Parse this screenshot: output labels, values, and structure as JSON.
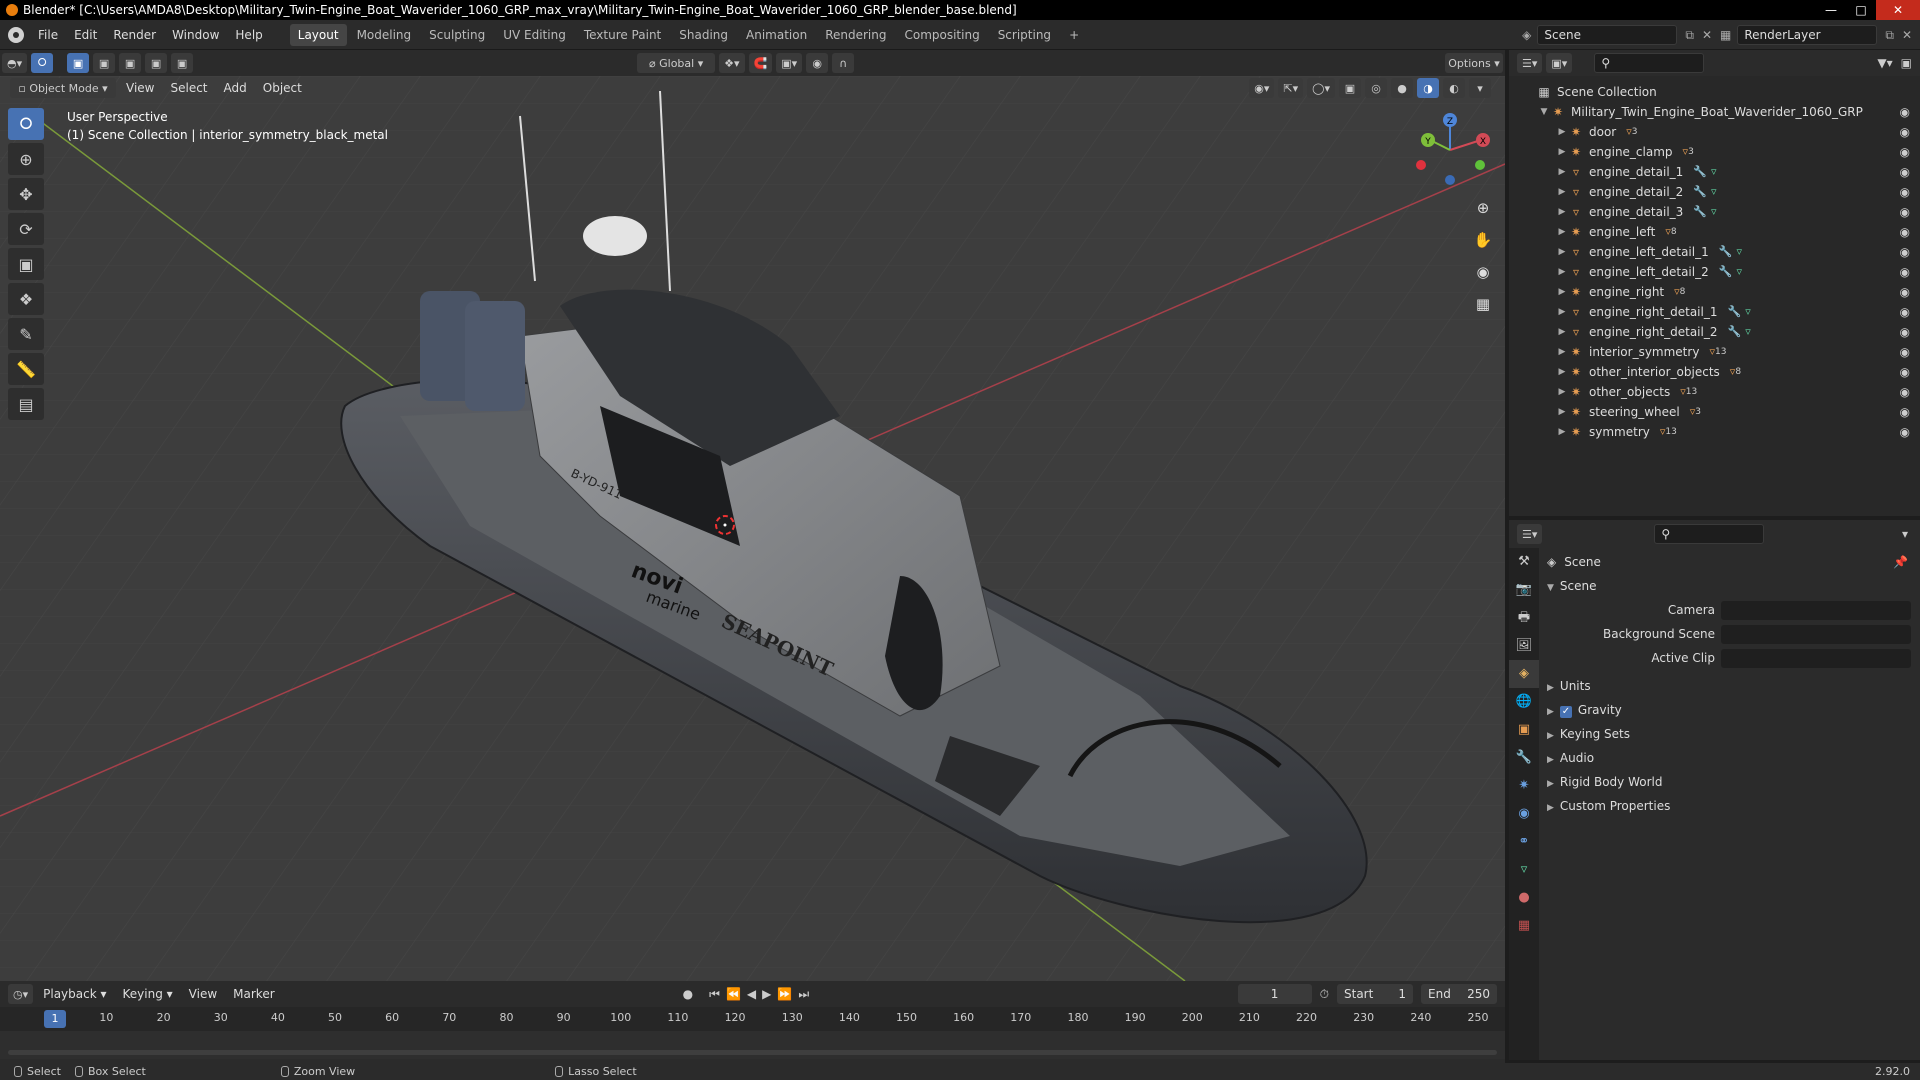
{
  "title": "Blender* [C:\\Users\\AMDA8\\Desktop\\Military_Twin-Engine_Boat_Waverider_1060_GRP_max_vray\\Military_Twin-Engine_Boat_Waverider_1060_GRP_blender_base.blend]",
  "menu": [
    "File",
    "Edit",
    "Render",
    "Window",
    "Help"
  ],
  "workspaces": [
    "Layout",
    "Modeling",
    "Sculpting",
    "UV Editing",
    "Texture Paint",
    "Shading",
    "Animation",
    "Rendering",
    "Compositing",
    "Scripting"
  ],
  "active_workspace": "Layout",
  "scene_name": "Scene",
  "render_layer": "RenderLayer",
  "tool_header": {
    "orientation": "Global",
    "options": "Options"
  },
  "viewport": {
    "mode": "Object Mode",
    "menus": [
      "View",
      "Select",
      "Add",
      "Object"
    ],
    "info_line1": "User Perspective",
    "info_line2": "(1) Scene Collection | interior_symmetry_black_metal"
  },
  "gizmo": {
    "x": "X",
    "y": "Y",
    "z": "Z"
  },
  "boat_text": {
    "brand1": "novi",
    "brand2": "marine",
    "name": "SEAPOINT",
    "reg": "B-YD-911"
  },
  "outliner": {
    "root": "Scene Collection",
    "group": "Military_Twin_Engine_Boat_Waverider_1060_GRP",
    "items": [
      {
        "name": "door",
        "sub": "3"
      },
      {
        "name": "engine_clamp",
        "sub": "3"
      },
      {
        "name": "engine_detail_1",
        "sub": ""
      },
      {
        "name": "engine_detail_2",
        "sub": ""
      },
      {
        "name": "engine_detail_3",
        "sub": ""
      },
      {
        "name": "engine_left",
        "sub": "8"
      },
      {
        "name": "engine_left_detail_1",
        "sub": ""
      },
      {
        "name": "engine_left_detail_2",
        "sub": ""
      },
      {
        "name": "engine_right",
        "sub": "8"
      },
      {
        "name": "engine_right_detail_1",
        "sub": ""
      },
      {
        "name": "engine_right_detail_2",
        "sub": ""
      },
      {
        "name": "interior_symmetry",
        "sub": "13"
      },
      {
        "name": "other_interior_objects",
        "sub": "8"
      },
      {
        "name": "other_objects",
        "sub": "13"
      },
      {
        "name": "steering_wheel",
        "sub": "3"
      },
      {
        "name": "symmetry",
        "sub": "13"
      }
    ]
  },
  "properties": {
    "context": "Scene",
    "panel": "Scene",
    "camera_label": "Camera",
    "bg_label": "Background Scene",
    "clip_label": "Active Clip",
    "sections": [
      "Units",
      "Gravity",
      "Keying Sets",
      "Audio",
      "Rigid Body World",
      "Custom Properties"
    ]
  },
  "timeline": {
    "menus": [
      "Playback",
      "Keying",
      "View",
      "Marker"
    ],
    "current": "1",
    "start_label": "Start",
    "start": "1",
    "end_label": "End",
    "end": "250",
    "ticks": [
      "1",
      "10",
      "20",
      "30",
      "40",
      "50",
      "60",
      "70",
      "80",
      "90",
      "100",
      "110",
      "120",
      "130",
      "140",
      "150",
      "160",
      "170",
      "180",
      "190",
      "200",
      "210",
      "220",
      "230",
      "240",
      "250"
    ]
  },
  "status": {
    "select": "Select",
    "box": "Box Select",
    "zoom": "Zoom View",
    "lasso": "Lasso Select",
    "version": "2.92.0"
  }
}
